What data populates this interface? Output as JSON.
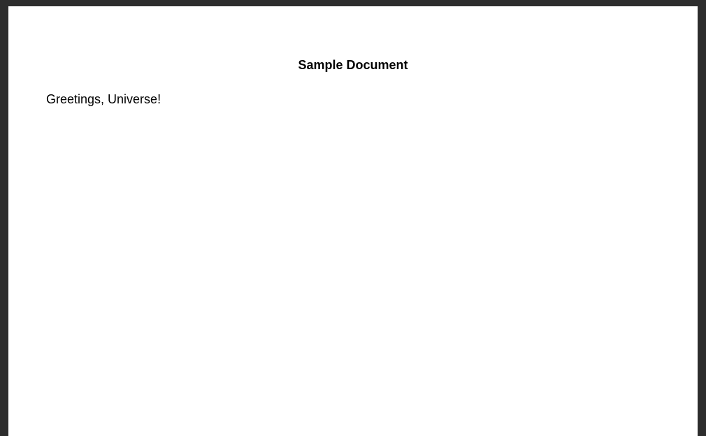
{
  "document": {
    "title": "Sample Document",
    "body": "Greetings, Universe!"
  }
}
